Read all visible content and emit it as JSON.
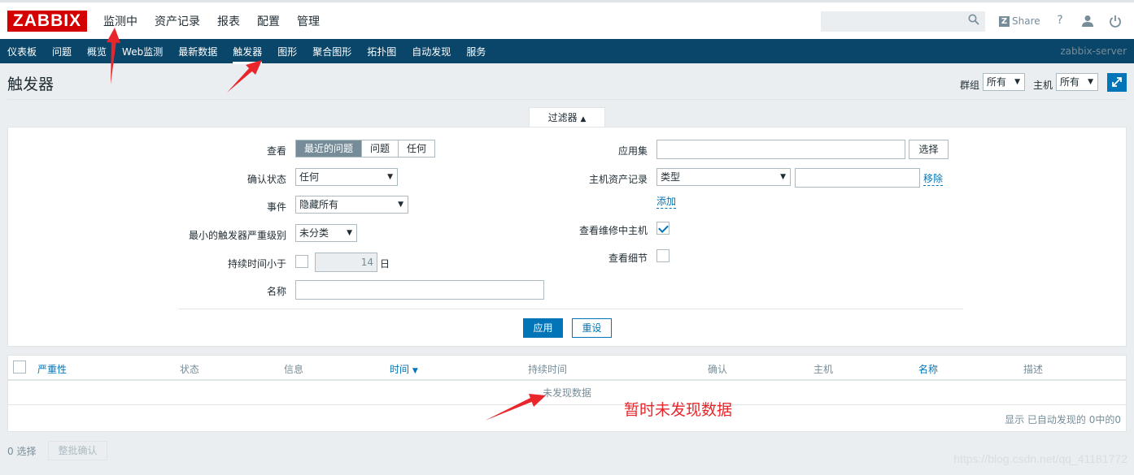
{
  "header": {
    "logo": "ZABBIX",
    "menu": [
      "监测中",
      "资产记录",
      "报表",
      "配置",
      "管理"
    ],
    "share": "Share",
    "help": "?"
  },
  "subnav": {
    "items": [
      "仪表板",
      "问题",
      "概览",
      "Web监测",
      "最新数据",
      "触发器",
      "图形",
      "聚合图形",
      "拓扑图",
      "自动发现",
      "服务"
    ],
    "active": "触发器",
    "server": "zabbix-server"
  },
  "page": {
    "title": "触发器",
    "group_label": "群组",
    "group_value": "所有",
    "host_label": "主机",
    "host_value": "所有"
  },
  "filter": {
    "tab_label": "过滤器",
    "view_label": "查看",
    "view_options": [
      "最近的问题",
      "问题",
      "任何"
    ],
    "view_selected": "最近的问题",
    "ack_label": "确认状态",
    "ack_value": "任何",
    "events_label": "事件",
    "events_value": "隐藏所有",
    "severity_label": "最小的触发器严重级别",
    "severity_value": "未分类",
    "age_label": "持续时间小于",
    "age_value": "14",
    "age_unit": "日",
    "name_label": "名称",
    "app_label": "应用集",
    "select_label": "选择",
    "inventory_label": "主机资产记录",
    "inventory_type": "类型",
    "remove_label": "移除",
    "add_label": "添加",
    "maintenance_label": "查看维修中主机",
    "maintenance_checked": true,
    "details_label": "查看细节",
    "details_checked": false,
    "apply": "应用",
    "reset": "重设"
  },
  "table": {
    "columns": [
      "严重性",
      "状态",
      "信息",
      "时间",
      "持续时间",
      "确认",
      "主机",
      "名称",
      "描述"
    ],
    "no_data": "未发现数据",
    "paging": "显示 已自动发现的 0中的0"
  },
  "footer": {
    "selected": "0 选择",
    "mass_ack": "整批确认",
    "watermark": "https://blog.csdn.net/qq_41181772"
  },
  "annotation": {
    "text": "暂时未发现数据",
    "color": "#e8262b"
  }
}
